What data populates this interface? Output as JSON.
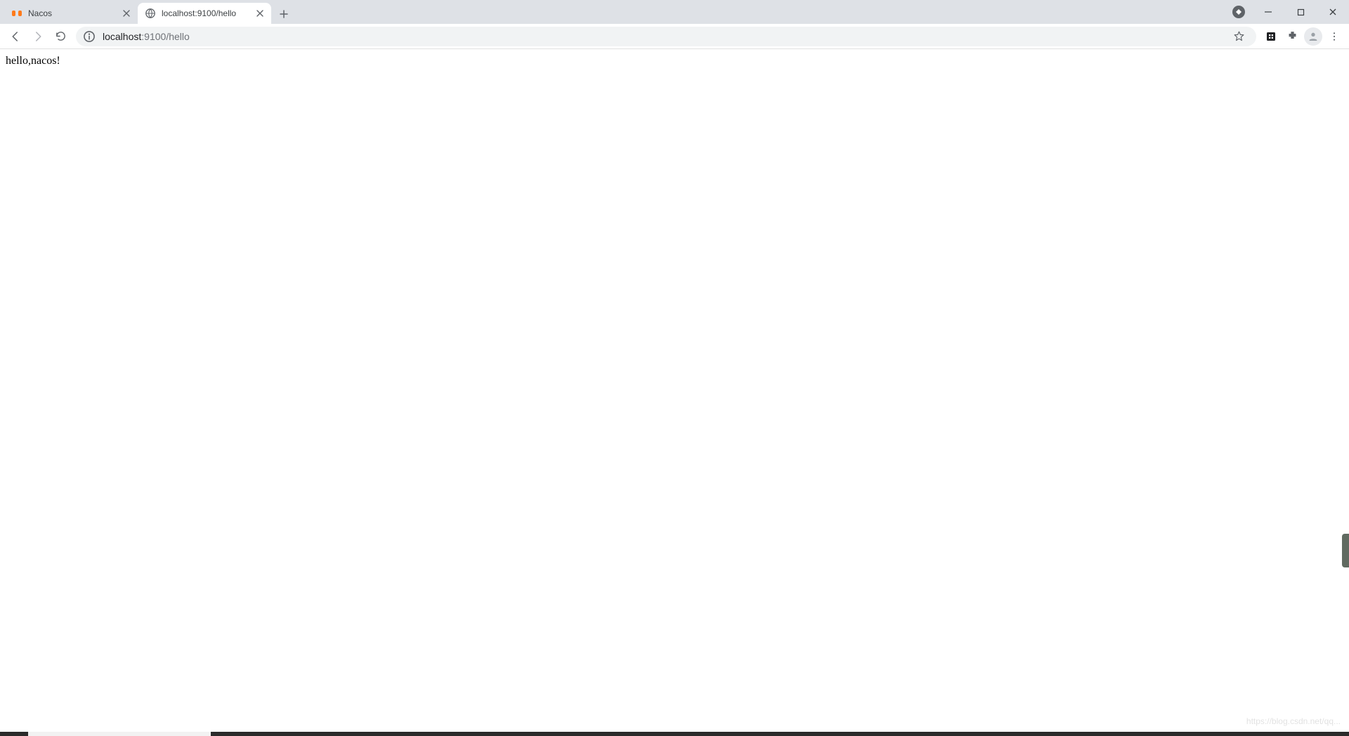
{
  "tabs": [
    {
      "title": "Nacos",
      "active": false
    },
    {
      "title": "localhost:9100/hello",
      "active": true
    }
  ],
  "address": {
    "host": "localhost",
    "port": "9100",
    "path": "/hello"
  },
  "page": {
    "body_text": "hello,nacos!"
  },
  "watermark": "https://blog.csdn.net/qq..."
}
